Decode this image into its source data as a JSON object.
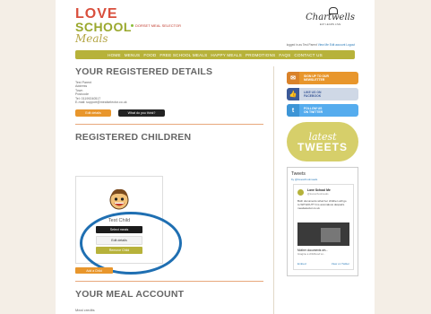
{
  "header": {
    "logo": {
      "line1": "LOVE",
      "line2": "SCHOOL",
      "line3": "Meals"
    },
    "region_selector": "DORSET MEAL SELECTOR",
    "brand": {
      "name": "Chartwells",
      "tagline": "EAT LEARN LIVE"
    },
    "login_status": {
      "prefix": "logged in as Test Parent",
      "links": [
        "View Me",
        "Edit account",
        "Logout"
      ]
    }
  },
  "nav": {
    "items": [
      "HOME",
      "MENUS",
      "FOOD",
      "FREE SCHOOL MEALS",
      "HAPPY MEALS",
      "PROMOTIONS",
      "FAQS",
      "CONTACT US"
    ]
  },
  "registered_details": {
    "title": "YOUR REGISTERED DETAILS",
    "lines": [
      "Test Parent",
      "Address",
      "Town",
      "Postcode",
      "Tel: 01199240517",
      "E-mail: support@mealselector.co.uk"
    ],
    "edit_button": "Edit details",
    "feedback_button": "What do you think?"
  },
  "registered_children": {
    "title": "REGISTERED CHILDREN",
    "child": {
      "name": "Test Child",
      "select_meals": "Select meals",
      "edit_details": "Edit details",
      "remove_child": "Remove Child"
    },
    "add_child": "Add a Child"
  },
  "meal_account": {
    "title": "YOUR MEAL ACCOUNT",
    "subtitle": "Meal credits"
  },
  "sidebar": {
    "signup": {
      "line1": "SIGN UP TO OUR",
      "line2": "NEWSLETTER"
    },
    "facebook": {
      "line1": "LIKE US ON",
      "line2": "FACEBOOK"
    },
    "twitter": {
      "line1": "FOLLOW US",
      "line2": "ON TWITTER"
    },
    "latest_tweets": {
      "line1": "latest",
      "line2": "TWEETS"
    },
    "tweets_widget": {
      "title": "Tweets",
      "by": "by @loveschoolmeals",
      "author": "Love School Me",
      "handle": "@loveschoolmeals",
      "body": "Both documents what her children will go to WITHOUT? It is anomalous despairs. mealselector.co.uk",
      "caption1": "Mother documents wh...",
      "caption2": "Imagine a childhood wi...",
      "embed": "Embed",
      "view_on_twitter": "View on Twitter"
    },
    "colors": {
      "orange": "#e8962c",
      "facebook": "#3b5998",
      "twitter": "#55acee",
      "olive": "#b7b23a"
    }
  }
}
